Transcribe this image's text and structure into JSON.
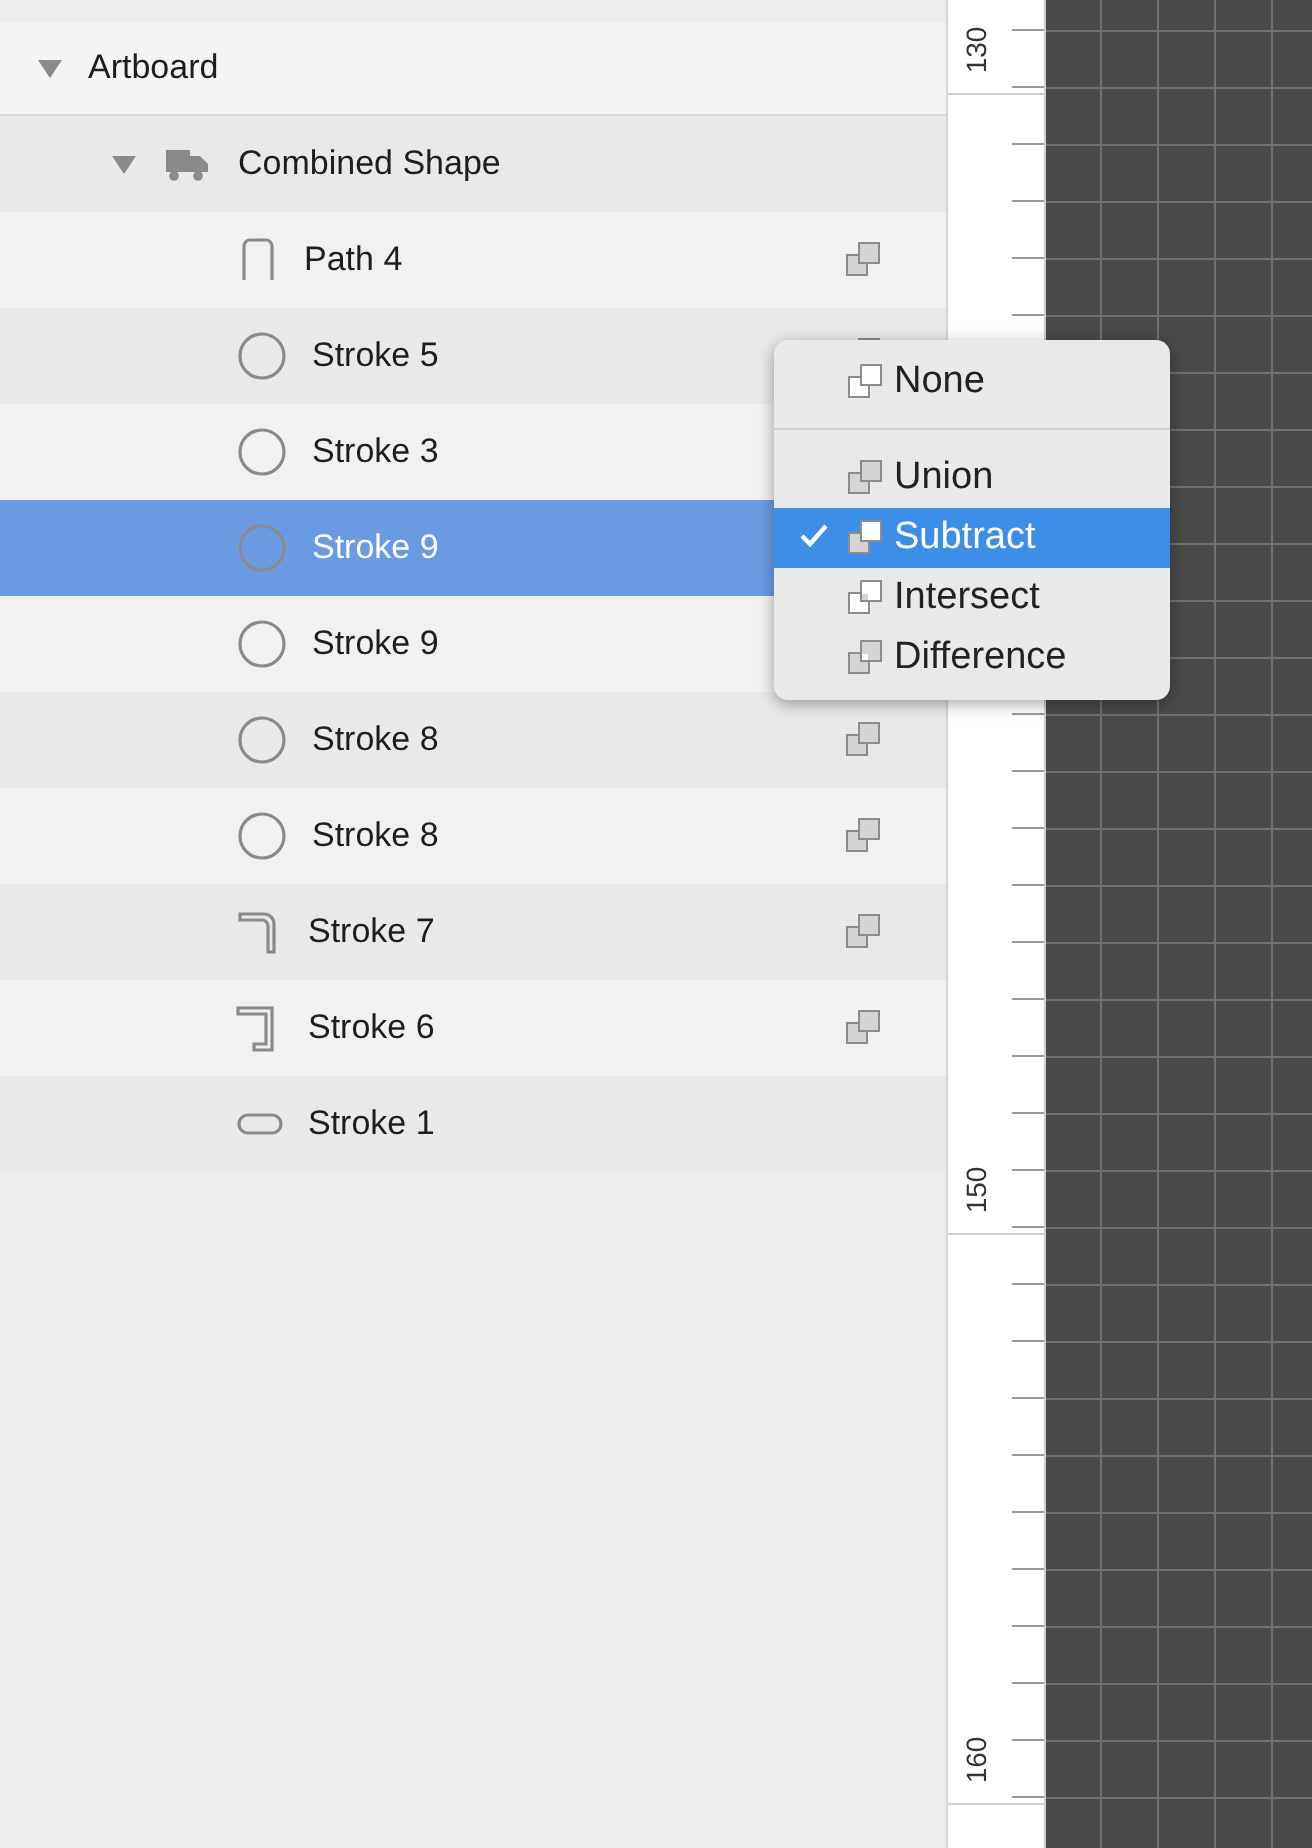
{
  "layers": [
    {
      "name": "Artboard",
      "expanded": true,
      "selected": false,
      "children": [
        {
          "name": "Combined Shape",
          "kind": "combined",
          "expanded": true,
          "selected": false,
          "children": [
            {
              "name": "Path 4",
              "kind": "path",
              "selected": false,
              "op_icon": true
            },
            {
              "name": "Stroke 5",
              "kind": "oval",
              "selected": false,
              "op_icon": true
            },
            {
              "name": "Stroke 3",
              "kind": "oval",
              "selected": false,
              "op_icon": false
            },
            {
              "name": "Stroke 9",
              "kind": "oval",
              "selected": true,
              "op_icon": false
            },
            {
              "name": "Stroke 9",
              "kind": "oval",
              "selected": false,
              "op_icon": false
            },
            {
              "name": "Stroke 8",
              "kind": "oval",
              "selected": false,
              "op_icon": true
            },
            {
              "name": "Stroke 8",
              "kind": "oval",
              "selected": false,
              "op_icon": true
            },
            {
              "name": "Stroke 7",
              "kind": "corner",
              "selected": false,
              "op_icon": true
            },
            {
              "name": "Stroke 6",
              "kind": "bracket",
              "selected": false,
              "op_icon": true
            },
            {
              "name": "Stroke 1",
              "kind": "capsule",
              "selected": false,
              "op_icon": false
            }
          ]
        }
      ]
    }
  ],
  "ruler": {
    "labels": [
      "130",
      "150",
      "160"
    ]
  },
  "menu": {
    "groups": [
      [
        {
          "label": "None",
          "kind": "none",
          "selected": false
        }
      ],
      [
        {
          "label": "Union",
          "kind": "union",
          "selected": false
        },
        {
          "label": "Subtract",
          "kind": "subtract",
          "selected": true
        },
        {
          "label": "Intersect",
          "kind": "intersect",
          "selected": false
        },
        {
          "label": "Difference",
          "kind": "difference",
          "selected": false
        }
      ]
    ]
  }
}
